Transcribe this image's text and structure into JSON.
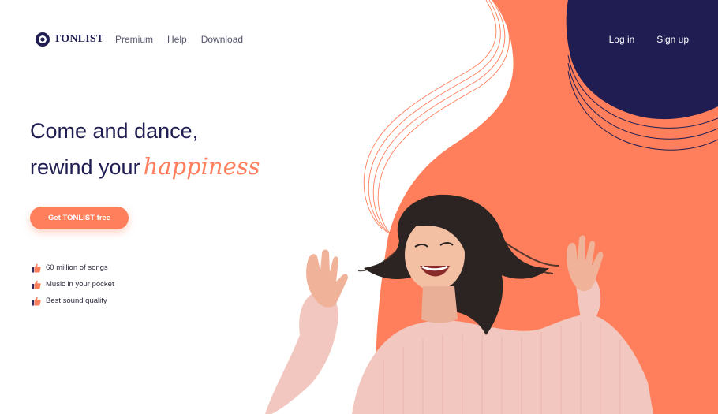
{
  "brand": {
    "name": "TONLIST",
    "logo_icon": "vinyl-disc-icon"
  },
  "nav": {
    "links": [
      "Premium",
      "Help",
      "Download"
    ]
  },
  "auth": {
    "login_label": "Log in",
    "signup_label": "Sign up"
  },
  "hero": {
    "headline_line1": "Come and dance,",
    "headline_line2": "rewind your",
    "headline_accent": "happiness",
    "cta_label": "Get TONLIST free"
  },
  "features": [
    {
      "icon": "thumbs-up-icon",
      "label": "60 million of songs"
    },
    {
      "icon": "thumbs-up-icon",
      "label": "Music in your pocket"
    },
    {
      "icon": "thumbs-up-icon",
      "label": "Best sound quality"
    }
  ],
  "colors": {
    "coral": "#ff7f5c",
    "navy": "#1f1d52",
    "text": "#2a2a3d",
    "sweater": "#f2c7bf",
    "hair": "#2b2422"
  }
}
